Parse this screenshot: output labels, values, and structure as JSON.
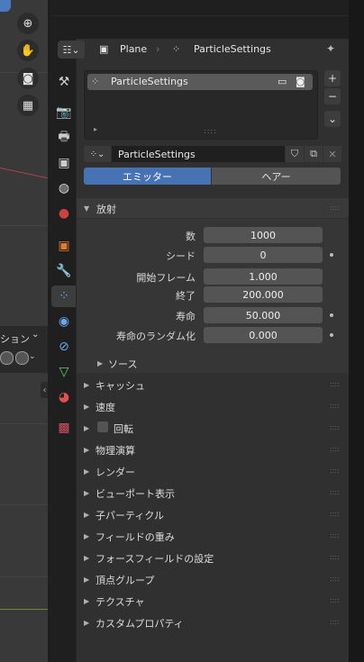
{
  "properties": {
    "breadcrumb": {
      "object": "Plane",
      "settings": "ParticleSettings"
    },
    "list": {
      "item_label": "ParticleSettings"
    },
    "datablock_name": "ParticleSettings",
    "type_tabs": {
      "emitter": "エミッター",
      "hair": "ヘアー"
    },
    "emission": {
      "title": "放射",
      "fields": [
        {
          "label": "数",
          "value": "1000",
          "animatable": false
        },
        {
          "label": "シード",
          "value": "0",
          "animatable": true
        },
        {
          "label": "開始フレーム",
          "value": "1.000",
          "animatable": false
        },
        {
          "label": "終了",
          "value": "200.000",
          "animatable": false
        },
        {
          "label": "寿命",
          "value": "50.000",
          "animatable": true
        },
        {
          "label": "寿命のランダム化",
          "value": "0.000",
          "animatable": true
        }
      ],
      "source": "ソース"
    },
    "panels": [
      "キャッシュ",
      "速度",
      "回転",
      "物理演算",
      "レンダー",
      "ビューポート表示",
      "子パーティクル",
      "フィールドの重み",
      "フォースフィールドの設定",
      "頂点グループ",
      "テクスチャ",
      "カスタムプロパティ"
    ]
  },
  "viewport": {
    "mode_text": "ション"
  },
  "colors": {
    "accent": "#4772b3",
    "panel_bg": "#303030",
    "field_bg": "#545454"
  },
  "icons": {
    "nav": [
      "zoom-icon",
      "hand-pan-icon",
      "camera-icon",
      "grid-icon"
    ],
    "tabs": [
      "tool-icon",
      "render-icon",
      "output-icon",
      "view-layer-icon",
      "scene-icon",
      "world-icon",
      "object-icon",
      "modifier-icon",
      "particles-icon",
      "physics-icon",
      "constraints-icon",
      "data-icon",
      "material-icon",
      "texture-icon"
    ]
  }
}
